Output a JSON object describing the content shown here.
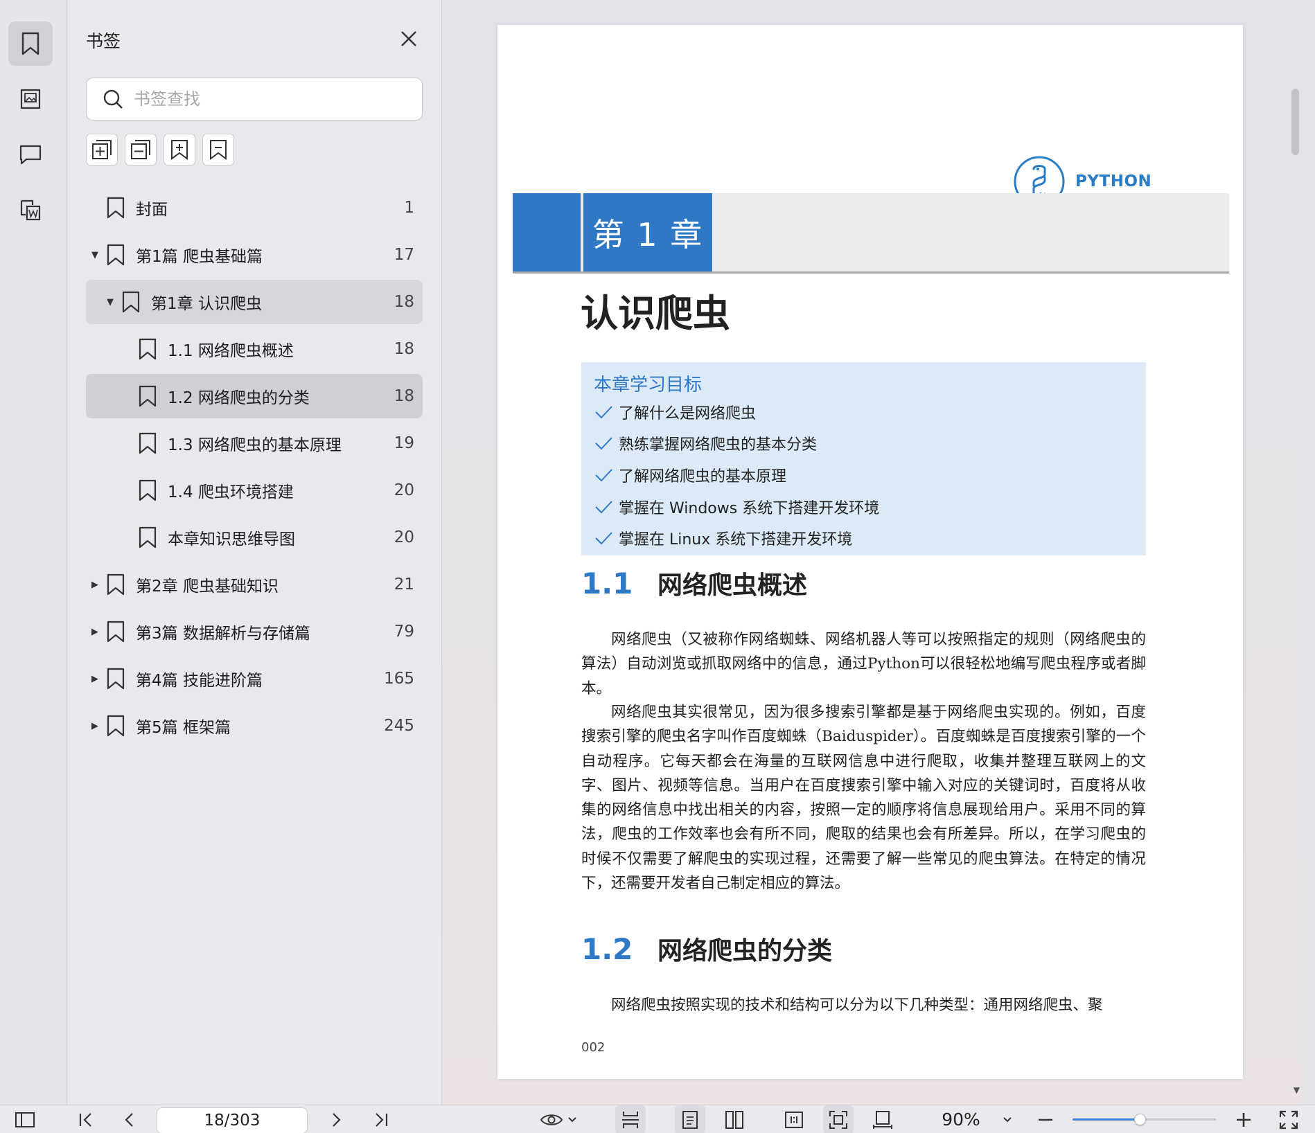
{
  "sidebar_panel": {
    "title": "书签",
    "search_placeholder": "书签查找",
    "bookmarks": [
      {
        "label": "封面",
        "page": "1",
        "level": 0,
        "arrow": ""
      },
      {
        "label": "第1篇  爬虫基础篇",
        "page": "17",
        "level": 0,
        "arrow": "▼"
      },
      {
        "label": "第1章  认识爬虫",
        "page": "18",
        "level": 1,
        "arrow": "▼"
      },
      {
        "label": "1.1 网络爬虫概述",
        "page": "18",
        "level": 2,
        "arrow": ""
      },
      {
        "label": "1.2  网络爬虫的分类",
        "page": "18",
        "level": 2,
        "arrow": ""
      },
      {
        "label": "1.3  网络爬虫的基本原理",
        "page": "19",
        "level": 2,
        "arrow": ""
      },
      {
        "label": "1.4  爬虫环境搭建",
        "page": "20",
        "level": 2,
        "arrow": ""
      },
      {
        "label": "本章知识思维导图",
        "page": "20",
        "level": 2,
        "arrow": ""
      },
      {
        "label": "第2章  爬虫基础知识",
        "page": "21",
        "level": 0,
        "arrow": "▶"
      },
      {
        "label": "第3篇  数据解析与存储篇",
        "page": "79",
        "level": 0,
        "arrow": "▶"
      },
      {
        "label": "第4篇  技能进阶篇",
        "page": "165",
        "level": 0,
        "arrow": "▶"
      },
      {
        "label": "第5篇  框架篇",
        "page": "245",
        "level": 0,
        "arrow": "▶"
      }
    ]
  },
  "page": {
    "logo_text": "PYTHON",
    "chapter_label": "第 1 章",
    "chapter_title": "认识爬虫",
    "goals_title": "本章学习目标",
    "goals": [
      "了解什么是网络爬虫",
      "熟练掌握网络爬虫的基本分类",
      "了解网络爬虫的基本原理",
      "掌握在 Windows 系统下搭建开发环境",
      "掌握在 Linux 系统下搭建开发环境"
    ],
    "sec1_num": "1.1",
    "sec1_title": "网络爬虫概述",
    "sec1_p1": "网络爬虫（又被称作网络蜘蛛、网络机器人等可以按照指定的规则（网络爬虫的算法）自动浏览或抓取网络中的信息，通过Python可以很轻松地编写爬虫程序或者脚本。",
    "sec1_p2": "网络爬虫其实很常见，因为很多搜索引擎都是基于网络爬虫实现的。例如，百度搜索引擎的爬虫名字叫作百度蜘蛛（Baiduspider）。百度蜘蛛是百度搜索引擎的一个自动程序。它每天都会在海量的互联网信息中进行爬取，收集并整理互联网上的文字、图片、视频等信息。当用户在百度搜索引擎中输入对应的关键词时，百度将从收集的网络信息中找出相关的内容，按照一定的顺序将信息展现给用户。采用不同的算法，爬虫的工作效率也会有所不同，爬取的结果也会有所差异。所以，在学习爬虫的时候不仅需要了解爬虫的实现过程，还需要了解一些常见的爬虫算法。在特定的情况下，还需要开发者自己制定相应的算法。",
    "sec2_num": "1.2",
    "sec2_title": "网络爬虫的分类",
    "sec2_p1": "网络爬虫按照实现的技术和结构可以分为以下几种类型：通用网络爬虫、聚",
    "page_number": "002"
  },
  "bottom_bar": {
    "page_indicator": "18/303",
    "zoom": "90%",
    "zoom_level": 0.47
  },
  "colors": {
    "accent": "#2f78c5",
    "goals_bg": "#dbeaf6",
    "selected_row": "#d0cfd6"
  }
}
